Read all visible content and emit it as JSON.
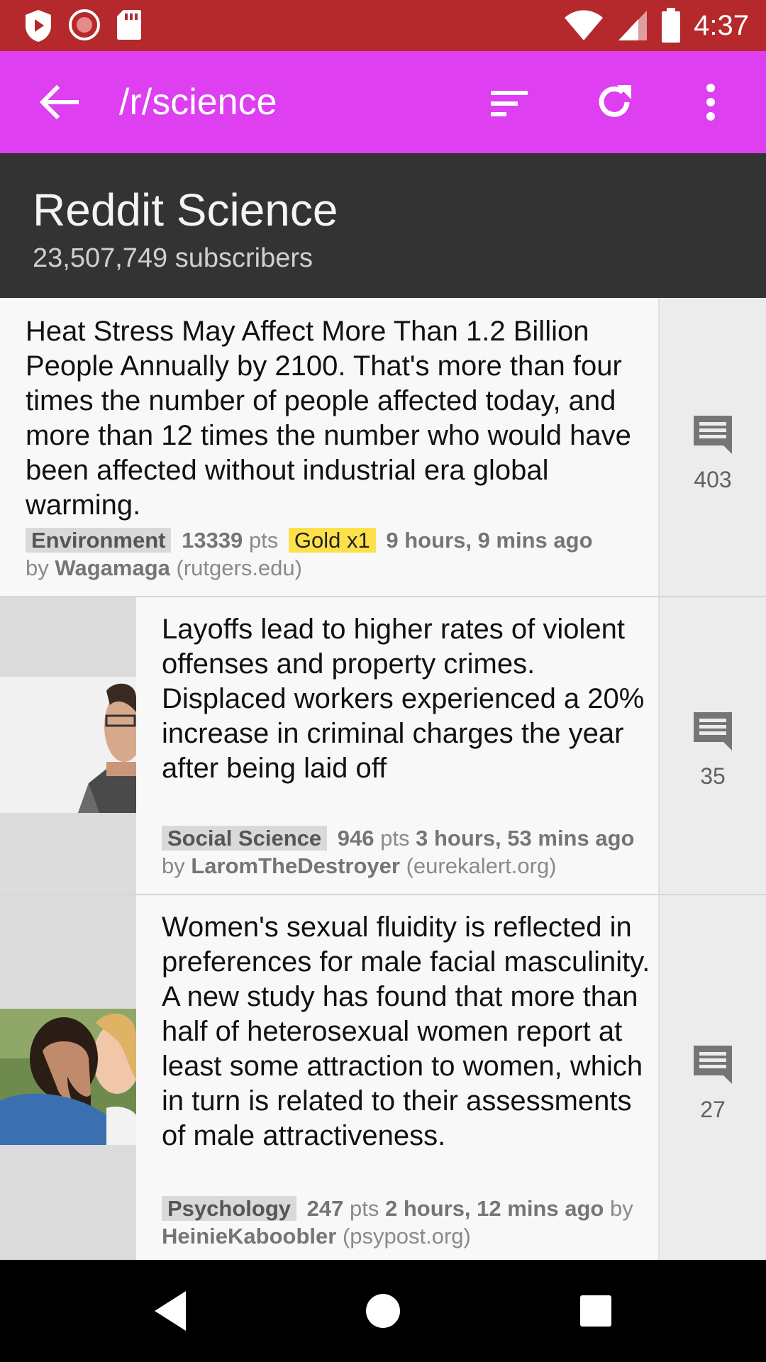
{
  "status_bar": {
    "time": "4:37",
    "icons": [
      "shield-play-icon",
      "record-icon",
      "sd-card-icon",
      "wifi-icon",
      "signal-icon",
      "battery-icon"
    ],
    "color": "#b5282b"
  },
  "toolbar": {
    "title": "/r/science",
    "color": "#dd3ff1",
    "icons": [
      "back-arrow-icon",
      "sort-icon",
      "refresh-icon",
      "more-vert-icon"
    ]
  },
  "subreddit": {
    "name": "Reddit Science",
    "subscribers": "23,507,749 subscribers"
  },
  "posts": [
    {
      "title": "Heat Stress May Affect More Than 1.2 Billion People Annually by 2100. That's more than four times the number of people affected today, and more than 12 times the number who would have been affected without industrial era global warming.",
      "flair": "Environment",
      "points": "13339",
      "pts_label": "pts",
      "gold": "Gold x1",
      "time": "9 hours, 9 mins ago",
      "by_label": "by",
      "author": "Wagamaga",
      "domain": "(rutgers.edu)",
      "comments": "403",
      "has_thumbnail": false
    },
    {
      "title": "Layoffs lead to higher rates of violent offenses and property crimes. Displaced workers experienced a 20% increase in criminal charges the year after being laid off",
      "flair": "Social Science",
      "points": "946",
      "pts_label": "pts",
      "time": "3 hours, 53 mins ago",
      "by_label": "by",
      "author": "LaromTheDestroyer",
      "domain": "(eurekalert.org)",
      "comments": "35",
      "has_thumbnail": true
    },
    {
      "title": "Women's sexual fluidity is reflected in preferences for male facial masculinity. A new study has found that more than half of heterosexual women report at least some attraction to women, which in turn is related to their assessments of male attractiveness.",
      "flair": "Psychology",
      "points": "247",
      "pts_label": "pts",
      "time": "2 hours, 12 mins ago",
      "by_label": "by",
      "author": "HeinieKaboobler",
      "domain": "(psypost.org)",
      "comments": "27",
      "has_thumbnail": true
    }
  ],
  "nav_bar": {
    "icons": [
      "back-triangle-icon",
      "home-circle-icon",
      "recents-square-icon"
    ]
  }
}
